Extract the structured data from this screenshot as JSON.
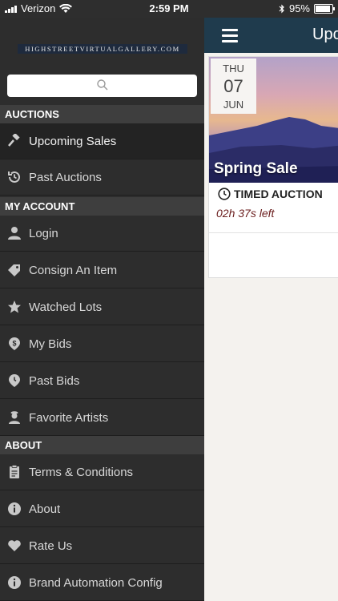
{
  "status": {
    "carrier": "Verizon",
    "time": "2:59 PM",
    "battery": "95%"
  },
  "logo": {
    "text": "HIGHSTREETVIRTUALGALLERY.COM"
  },
  "search": {
    "placeholder": ""
  },
  "sections": {
    "auctions": "AUCTIONS",
    "account": "MY ACCOUNT",
    "about": "ABOUT"
  },
  "menu": {
    "upcoming": "Upcoming Sales",
    "past_auctions": "Past Auctions",
    "login": "Login",
    "consign": "Consign An Item",
    "watched": "Watched Lots",
    "my_bids": "My Bids",
    "past_bids": "Past Bids",
    "favorite_artists": "Favorite Artists",
    "terms": "Terms & Conditions",
    "about": "About",
    "rate": "Rate Us",
    "brand": "Brand Automation Config"
  },
  "main": {
    "title": "Upcoming Sales",
    "card": {
      "dow": "THU",
      "day": "07",
      "month": "JUN",
      "title": "Spring Sale",
      "type": "TIMED AUCTION",
      "time_left": "02h 37s left"
    }
  },
  "colors": {
    "navbar": "#1f3b4d",
    "sidebar": "#2d2d2d",
    "accent_time": "#6b1e1e"
  }
}
